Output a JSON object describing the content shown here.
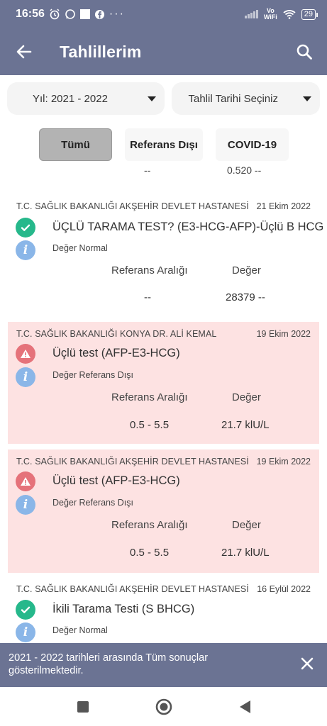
{
  "status_bar": {
    "time": "16:56",
    "battery": "29",
    "vowifi_line1": "Vo",
    "vowifi_line2": "WiFi",
    "icons": [
      "alarm-icon",
      "whatsapp-icon",
      "square-icon",
      "facebook-icon",
      "more-icon",
      "signal-icon",
      "wifi-icon",
      "battery-icon"
    ]
  },
  "app_bar": {
    "title": "Tahlillerim"
  },
  "filters": {
    "year": "Yıl: 2021 - 2022",
    "date_select": "Tahlil Tarihi Seçiniz"
  },
  "tabs": [
    {
      "label": "Tümü",
      "active": true
    },
    {
      "label": "Referans Dışı",
      "active": false
    },
    {
      "label": "COVID-19",
      "active": false
    }
  ],
  "partial_row": {
    "ref": "--",
    "value": "0.520 --"
  },
  "headers": {
    "reference": "Referans Aralığı",
    "value": "Değer"
  },
  "results": [
    {
      "hospital": "T.C. SAĞLIK BAKANLIĞI AKŞEHİR DEVLET HASTANESİ",
      "date": "21 Ekim 2022",
      "test": "ÜÇLÜ TARAMA TEST? (E3-HCG-AFP)-Üçlü B HCG",
      "note": "Değer Normal",
      "status": "normal",
      "ref": "--",
      "value": "28379 --"
    },
    {
      "hospital": "T.C. SAĞLIK BAKANLIĞI KONYA DR. ALİ KEMAL",
      "date": "19 Ekim 2022",
      "test": "Üçlü test (AFP-E3-HCG)",
      "note": "Değer Referans Dışı",
      "status": "abnormal",
      "ref": "0.5 - 5.5",
      "value": "21.7 klU/L"
    },
    {
      "hospital": "T.C. SAĞLIK BAKANLIĞI AKŞEHİR DEVLET HASTANESİ",
      "date": "19 Ekim 2022",
      "test": "Üçlü test (AFP-E3-HCG)",
      "note": "Değer Referans Dışı",
      "status": "abnormal",
      "ref": "0.5 - 5.5",
      "value": "21.7 klU/L"
    },
    {
      "hospital": "T.C. SAĞLIK BAKANLIĞI AKŞEHİR DEVLET HASTANESİ",
      "date": "16 Eylül 2022",
      "test": "İkili Tarama Testi (S BHCG)",
      "note": "Değer Normal",
      "status": "normal"
    }
  ],
  "snackbar": {
    "message": "2021 - 2022 tarihleri arasında Tüm sonuçlar gösterilmektedir."
  },
  "colors": {
    "primary": "#6b7393",
    "ok": "#26b88b",
    "warn": "#e5727a",
    "info": "#8ab6e8",
    "abnormal_bg": "#fde2e2"
  }
}
